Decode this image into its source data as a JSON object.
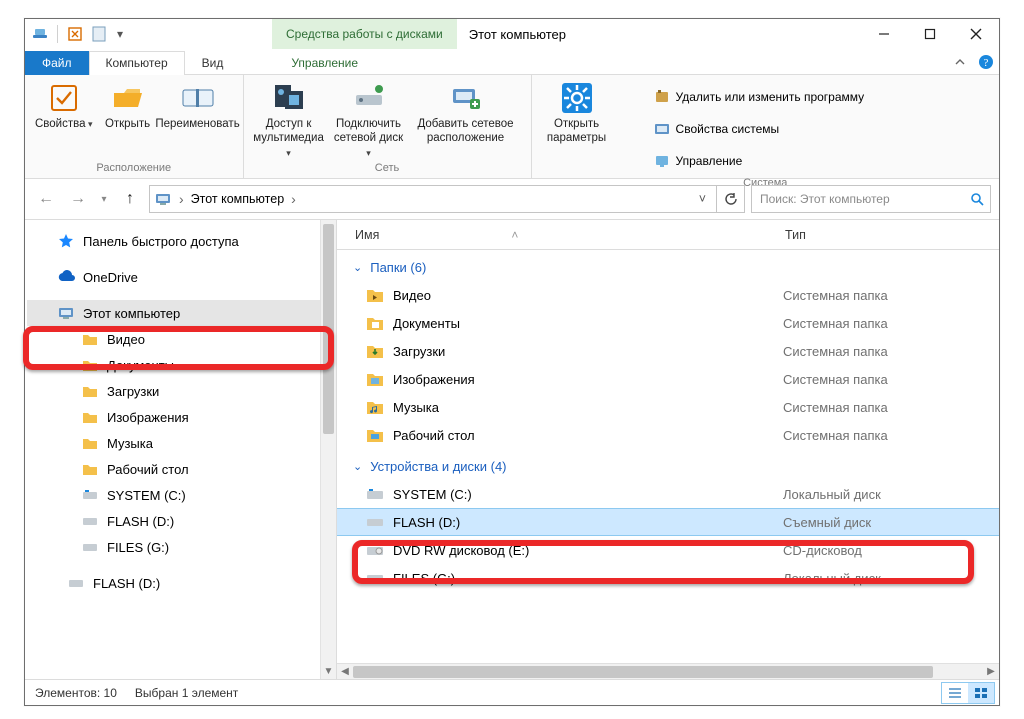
{
  "title": "Этот компьютер",
  "context_tab": "Средства работы с дисками",
  "tabs": {
    "file": "Файл",
    "computer": "Компьютер",
    "view": "Вид",
    "manage": "Управление"
  },
  "ribbon": {
    "location": {
      "label": "Расположение",
      "properties": "Свойства",
      "open": "Открыть",
      "rename": "Переименовать"
    },
    "network": {
      "label": "Сеть",
      "media": "Доступ к\nмультимедиа",
      "map_drive": "Подключить\nсетевой диск",
      "add_loc": "Добавить сетевое\nрасположение"
    },
    "system": {
      "label": "Система",
      "open_settings": "Открыть\nпараметры",
      "uninstall": "Удалить или изменить программу",
      "sysprops": "Свойства системы",
      "manage": "Управление"
    }
  },
  "breadcrumb": {
    "root": "Этот компьютер"
  },
  "search_placeholder": "Поиск: Этот компьютер",
  "nav": {
    "quick": "Панель быстрого доступа",
    "onedrive": "OneDrive",
    "thispc": "Этот компьютер",
    "videos": "Видео",
    "documents": "Документы",
    "downloads": "Загрузки",
    "pictures": "Изображения",
    "music": "Музыка",
    "desktop": "Рабочий стол",
    "system_c": "SYSTEM (C:)",
    "flash_d": "FLASH (D:)",
    "files_g": "FILES (G:)",
    "flash_d2": "FLASH (D:)"
  },
  "columns": {
    "name": "Имя",
    "type": "Тип"
  },
  "groups": {
    "folders": "Папки (6)",
    "drives": "Устройства и диски (4)"
  },
  "rows": {
    "videos": {
      "name": "Видео",
      "type": "Системная папка"
    },
    "documents": {
      "name": "Документы",
      "type": "Системная папка"
    },
    "downloads": {
      "name": "Загрузки",
      "type": "Системная папка"
    },
    "pictures": {
      "name": "Изображения",
      "type": "Системная папка"
    },
    "music": {
      "name": "Музыка",
      "type": "Системная папка"
    },
    "desktop": {
      "name": "Рабочий стол",
      "type": "Системная папка"
    },
    "system_c": {
      "name": "SYSTEM (C:)",
      "type": "Локальный диск"
    },
    "flash_d": {
      "name": "FLASH (D:)",
      "type": "Съемный диск"
    },
    "dvd_e": {
      "name": "DVD RW дисковод (E:)",
      "type": "CD-дисковод"
    },
    "files_g": {
      "name": "FILES (G:)",
      "type": "Локальный диск"
    }
  },
  "status": {
    "count": "Элементов: 10",
    "selection": "Выбран 1 элемент"
  }
}
